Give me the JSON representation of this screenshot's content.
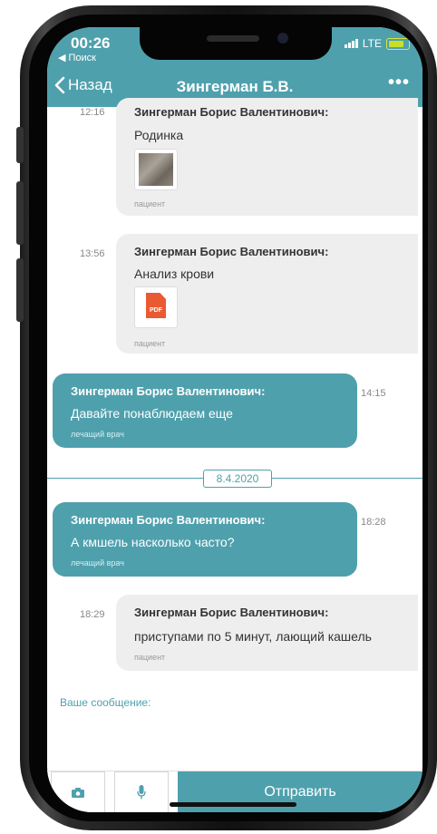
{
  "status": {
    "time": "00:26",
    "back_app": "◀ Поиск",
    "network": "LTE"
  },
  "nav": {
    "back": "Назад",
    "title": "Зингерман Б.В.",
    "more": "•••"
  },
  "messages": [
    {
      "time": "12:16",
      "sender": "Зингерман Борис Валентинович:",
      "text": "Родинка",
      "role": "пациент"
    },
    {
      "time": "13:56",
      "sender": "Зингерман Борис Валентинович:",
      "text": "Анализ крови",
      "role": "пациент",
      "attachment": "PDF"
    },
    {
      "time": "14:15",
      "sender": "Зингерман Борис Валентинович:",
      "text": "Давайте понаблюдаем еще",
      "role": "лечащий врач"
    },
    {
      "time": "18:28",
      "sender": "Зингерман Борис Валентинович:",
      "text": "А кмшель насколько часто?",
      "role": "лечащий врач"
    },
    {
      "time": "18:29",
      "sender": "Зингерман Борис Валентинович:",
      "text": "приступами по 5 минут, лающий кашель",
      "role": "пациент"
    }
  ],
  "date_separator": "8.4.2020",
  "composer": {
    "placeholder": "Ваше сообщение:",
    "send": "Отправить"
  },
  "colors": {
    "accent": "#4fa0ad",
    "incoming_bubble": "#eeeeee"
  }
}
